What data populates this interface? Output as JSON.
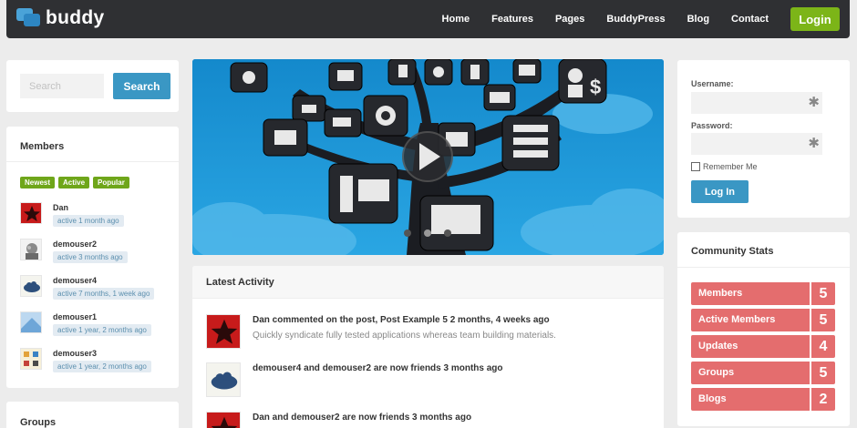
{
  "header": {
    "logo_text": "buddy",
    "nav": [
      "Home",
      "Features",
      "Pages",
      "BuddyPress",
      "Blog",
      "Contact"
    ],
    "login_label": "Login"
  },
  "search": {
    "placeholder": "Search",
    "button_label": "Search"
  },
  "members": {
    "title": "Members",
    "filters": [
      "Newest",
      "Active",
      "Popular"
    ],
    "items": [
      {
        "name": "Dan",
        "activity": "active 1 month ago"
      },
      {
        "name": "demouser2",
        "activity": "active 3 months ago"
      },
      {
        "name": "demouser4",
        "activity": "active 7 months, 1 week ago"
      },
      {
        "name": "demouser1",
        "activity": "active 1 year, 2 months ago"
      },
      {
        "name": "demouser3",
        "activity": "active 1 year, 2 months ago"
      }
    ]
  },
  "groups": {
    "title": "Groups"
  },
  "slider": {
    "slide_count": 3,
    "active_slide": 1
  },
  "activity": {
    "title": "Latest Activity",
    "items": [
      {
        "text": "Dan commented on the post, Post Example 5 2 months, 4 weeks ago",
        "sub": "Quickly syndicate fully tested applications whereas team building materials."
      },
      {
        "text": "demouser4 and demouser2 are now friends 3 months ago",
        "sub": ""
      },
      {
        "text": "Dan and demouser2 are now friends 3 months ago",
        "sub": ""
      }
    ]
  },
  "login": {
    "username_label": "Username:",
    "password_label": "Password:",
    "required_marker": "✱",
    "remember_label": "Remember Me",
    "button_label": "Log In"
  },
  "stats": {
    "title": "Community Stats",
    "items": [
      {
        "label": "Members",
        "value": "5"
      },
      {
        "label": "Active Members",
        "value": "5"
      },
      {
        "label": "Updates",
        "value": "4"
      },
      {
        "label": "Groups",
        "value": "5"
      },
      {
        "label": "Blogs",
        "value": "2"
      }
    ]
  },
  "colors": {
    "header_bg": "#2f3033",
    "accent_green": "#7cb518",
    "accent_blue": "#3a97c4",
    "stat_red": "#e46d6e",
    "page_bg": "#ececec"
  }
}
